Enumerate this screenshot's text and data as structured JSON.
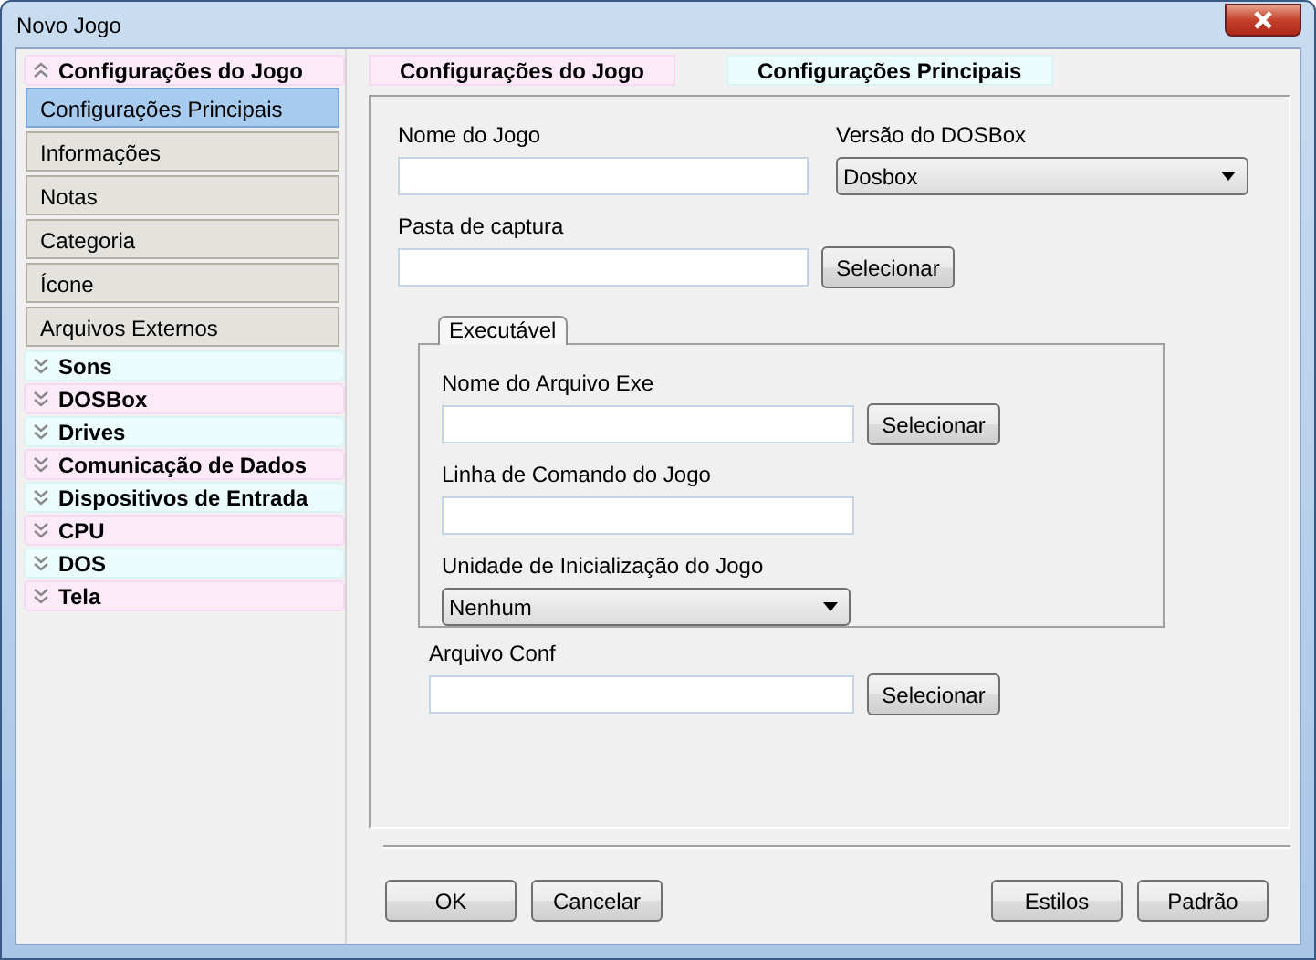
{
  "window": {
    "title": "Novo Jogo"
  },
  "sidebar": {
    "groups": [
      {
        "label": "Configurações do Jogo",
        "expanded": true,
        "items": [
          {
            "label": "Configurações Principais",
            "selected": true
          },
          {
            "label": "Informações",
            "selected": false
          },
          {
            "label": "Notas",
            "selected": false
          },
          {
            "label": "Categoria",
            "selected": false
          },
          {
            "label": "Ícone",
            "selected": false
          },
          {
            "label": "Arquivos Externos",
            "selected": false
          }
        ]
      },
      {
        "label": "Sons",
        "expanded": false
      },
      {
        "label": "DOSBox",
        "expanded": false
      },
      {
        "label": "Drives",
        "expanded": false
      },
      {
        "label": "Comunicação de Dados",
        "expanded": false
      },
      {
        "label": "Dispositivos de Entrada",
        "expanded": false
      },
      {
        "label": "CPU",
        "expanded": false
      },
      {
        "label": "DOS",
        "expanded": false
      },
      {
        "label": "Tela",
        "expanded": false
      }
    ]
  },
  "breadcrumb": [
    "Configurações do Jogo",
    "Configurações Principais"
  ],
  "form": {
    "game_name": {
      "label": "Nome do Jogo"
    },
    "dosbox_version": {
      "label": "Versão do DOSBox",
      "value": "Dosbox"
    },
    "capture_folder": {
      "label": "Pasta de captura",
      "button": "Selecionar"
    },
    "executable": {
      "tab": "Executável",
      "exe_file": {
        "label": "Nome do Arquivo Exe",
        "button": "Selecionar"
      },
      "command_line": {
        "label": "Linha de Comando do Jogo"
      },
      "boot_drive": {
        "label": "Unidade de Inicialização do Jogo",
        "value": "Nenhum"
      }
    },
    "conf_file": {
      "label": "Arquivo Conf",
      "button": "Selecionar"
    }
  },
  "buttons_left": [
    "OK",
    "Cancelar"
  ],
  "buttons_right": [
    "Estilos",
    "Padrão"
  ]
}
